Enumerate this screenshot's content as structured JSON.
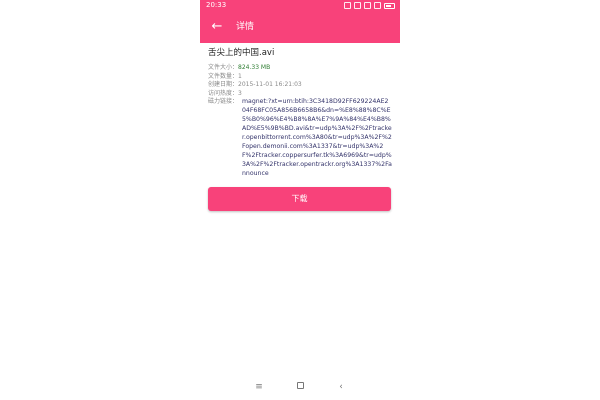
{
  "status_bar": {
    "time": "20:33"
  },
  "app_bar": {
    "back_icon": "←",
    "title": "详情"
  },
  "file": {
    "name": "舌尖上的中国.avi",
    "fields": [
      {
        "label": "文件大小：",
        "value": "824.33 MB",
        "color": "#2e7d32"
      },
      {
        "label": "文件数量：",
        "value": "1"
      },
      {
        "label": "创建日期：",
        "value": "2015-11-01 16:21:03"
      },
      {
        "label": "访问热度：",
        "value": "3"
      },
      {
        "label": "磁力链接：",
        "value": ""
      }
    ],
    "magnet": "magnet:?xt=urn:btih:3C3418D92FF629224AE204F68FC05A856B6658B6&dn=%E8%88%8C%E5%B0%96%E4%B8%8A%E7%9A%84%E4%B8%AD%E5%9B%BD.avi&tr=udp%3A%2F%2Ftracker.openbittorrent.com%3A80&tr=udp%3A%2F%2Fopen.demonii.com%3A1337&tr=udp%3A%2F%2Ftracker.coppersurfer.tk%3A6969&tr=udp%3A%2F%2Ftracker.opentrackr.org%3A1337%2Fannounce"
  },
  "actions": {
    "download_label": "下载"
  },
  "nav_bar": {
    "menu_icon": "≡",
    "back_icon": "‹"
  },
  "colors": {
    "accent": "#f8427a",
    "size_value": "#2e7d32",
    "magnet_text": "#33336a"
  }
}
